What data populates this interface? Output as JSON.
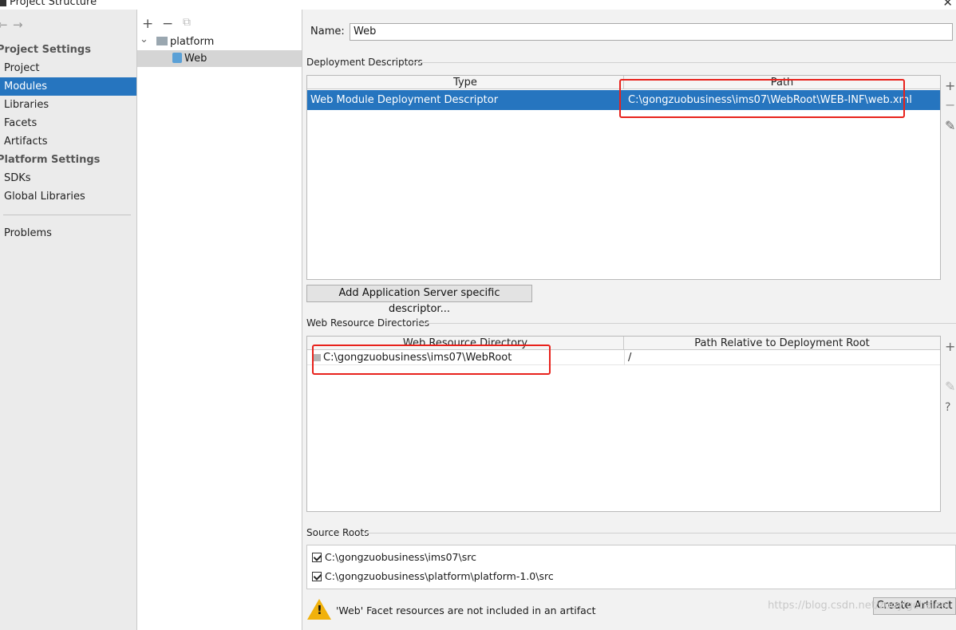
{
  "window": {
    "title": "Project Structure"
  },
  "nav": {
    "back_arrow": "←",
    "forward_arrow": "→",
    "project_settings_title": "Project Settings",
    "project_items": [
      "Project",
      "Modules",
      "Libraries",
      "Facets",
      "Artifacts"
    ],
    "platform_settings_title": "Platform Settings",
    "platform_items": [
      "SDKs",
      "Global Libraries"
    ],
    "problems": "Problems",
    "selected": "Modules"
  },
  "tree": {
    "add": "+",
    "remove": "−",
    "copy": "⧉",
    "chevron": "⌄",
    "root": "platform",
    "child": "Web"
  },
  "panel": {
    "name_label": "Name:",
    "name_value": "Web",
    "deployment_descriptors": {
      "title": "Deployment Descriptors",
      "columns": [
        "Type",
        "Path"
      ],
      "rows": [
        {
          "type": "Web Module Deployment Descriptor",
          "path": "C:\\gongzuobusiness\\ims07\\WebRoot\\WEB-INF\\web.xml"
        }
      ],
      "add_server_button": "Add Application Server specific descriptor..."
    },
    "web_resource_directories": {
      "title": "Web Resource Directories",
      "columns": [
        "Web Resource Directory",
        "Path Relative to Deployment Root"
      ],
      "rows": [
        {
          "directory": "C:\\gongzuobusiness\\ims07\\WebRoot",
          "relative": "/"
        }
      ]
    },
    "source_roots": {
      "title": "Source Roots",
      "items": [
        {
          "path": "C:\\gongzuobusiness\\ims07\\src",
          "checked": true
        },
        {
          "path": "C:\\gongzuobusiness\\platform\\platform-1.0\\src",
          "checked": true
        }
      ]
    },
    "warning": "'Web' Facet resources are not included in an artifact",
    "create_artifact_button": "Create Artifact",
    "side_tools": {
      "add": "+",
      "remove": "−",
      "edit": "✎",
      "help": "?"
    }
  },
  "watermark": "https://blog.csdn.net/zuoyigehaizei",
  "colors": {
    "selection": "#2675bf",
    "highlight_box": "#e8221c",
    "warning": "#f1b10b"
  }
}
